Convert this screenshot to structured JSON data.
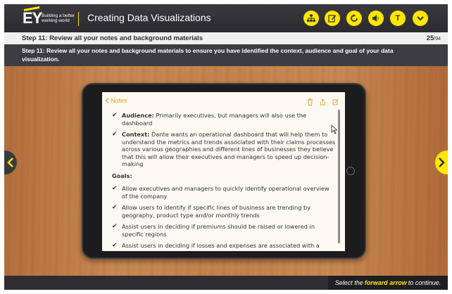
{
  "header": {
    "logo": "EY",
    "tagline": "Building a better working world",
    "title": "Creating Data Visualizations",
    "buttons": [
      "sitemap-icon",
      "notes-edit-icon",
      "replay-icon",
      "audio-icon",
      "transcript-icon",
      "menu-chevron-icon"
    ],
    "transcript_label": "T"
  },
  "step": {
    "title": "Step 11: Review all your notes and background materials",
    "current_page": "25",
    "total_pages": "/94",
    "instruction": "Step 11: Review all your notes and background materials to ensure you have identified the context, audience and goal of your data visualization."
  },
  "notes_app": {
    "back_label": "Notes",
    "items": [
      {
        "label": "Audience:",
        "text": " Primarily executives, but managers will also use the dashboard"
      },
      {
        "label": "Context:",
        "text": " Dante wants an operational dashboard that will help them to understand the metrics and trends associated with their claims processes across various geographies and different lines of businesses they believe that this will allow their executives and managers to speed up decision-making"
      }
    ],
    "goals_heading": "Goals:",
    "goals": [
      "Allow executives and managers to quickly identify operational overview of the company",
      "Allow users to identify if specific lines of business are trending by geography, product type and/or monthly trends",
      "Assist users in deciding if premiums should be raised or lowered in specific regions",
      "Assist users in deciding if losses and expenses are associated with a"
    ]
  },
  "footer": {
    "prefix": "Select the",
    "emphasis": "forward arrow",
    "suffix": "to continue."
  },
  "colors": {
    "accent": "#ffe600",
    "dark": "#2e2e32",
    "notes_accent": "#e2a81c"
  }
}
